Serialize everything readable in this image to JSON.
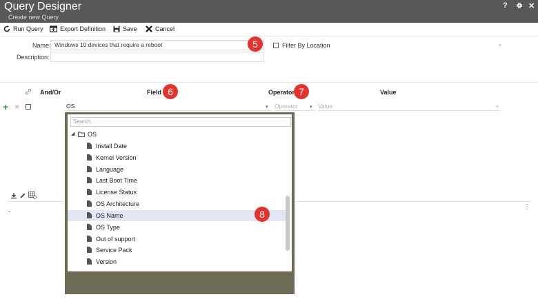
{
  "window": {
    "title": "Query Designer",
    "subtitle": "Create new Query",
    "help": "?",
    "restore": "↖↘",
    "close": "✕"
  },
  "toolbar": {
    "run_query": "Run Query",
    "export_definition": "Export Definition",
    "save": "Save",
    "cancel": "Cancel"
  },
  "form": {
    "name_label": "Name:",
    "name_value": "Windows 10 devices that require a reboot",
    "description_label": "Description:",
    "description_value": "",
    "filter_by_location": "Filter By Location"
  },
  "badges": {
    "b5": "5",
    "b6": "6",
    "b7": "7",
    "b8": "8"
  },
  "criteria": {
    "headers": {
      "and_or": "And/Or",
      "field": "Field",
      "operator": "Operator",
      "value": "Value"
    },
    "row": {
      "add": "+",
      "remove": "✕",
      "field_value": "OS",
      "operator_placeholder": "Operator",
      "value_placeholder": "Value"
    }
  },
  "dropdown": {
    "search_placeholder": "Search",
    "root": "OS",
    "items": [
      "Install Date",
      "Kernel Version",
      "Language",
      "Last Boot Time",
      "License Status",
      "OS Architecture",
      "OS Name",
      "OS Type",
      "Out of support",
      "Service Pack",
      "Version"
    ],
    "selected": "OS Name"
  },
  "results": {
    "dash": "-",
    "more": "⋮"
  }
}
